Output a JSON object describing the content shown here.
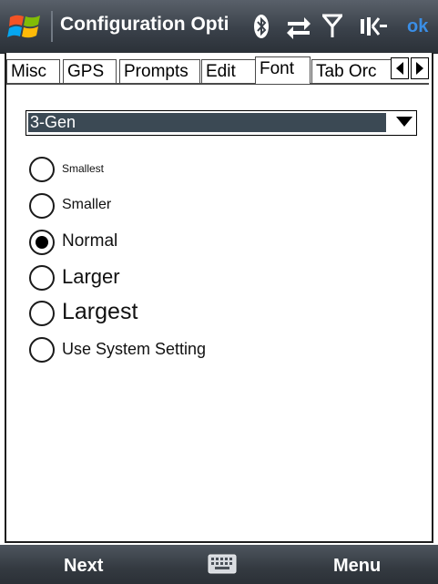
{
  "title_bar": {
    "title": "Configuration Opti",
    "ok_label": "ok",
    "icons": [
      "windows-start-icon",
      "bluetooth-icon",
      "connectivity-icon",
      "signal-icon",
      "volume-icon"
    ]
  },
  "tabs": [
    {
      "label": "Misc",
      "active": false
    },
    {
      "label": "GPS",
      "active": false
    },
    {
      "label": "Prompts",
      "active": false
    },
    {
      "label": "Edit",
      "active": false
    },
    {
      "label": "Font",
      "active": true
    },
    {
      "label": "Tab Orc",
      "active": false
    }
  ],
  "font_dropdown": {
    "selected": "3-Gen"
  },
  "font_size_options": [
    {
      "label": "Smallest",
      "selected": false
    },
    {
      "label": "Smaller",
      "selected": false
    },
    {
      "label": "Normal",
      "selected": true
    },
    {
      "label": "Larger",
      "selected": false
    },
    {
      "label": "Largest",
      "selected": false
    },
    {
      "label": "Use System Setting",
      "selected": false
    }
  ],
  "softkeys": {
    "left": "Next",
    "right": "Menu"
  },
  "colors": {
    "title_bar": "#3a414a",
    "dropdown_selection": "#3b4954",
    "ok_accent": "#3a8ee6"
  }
}
